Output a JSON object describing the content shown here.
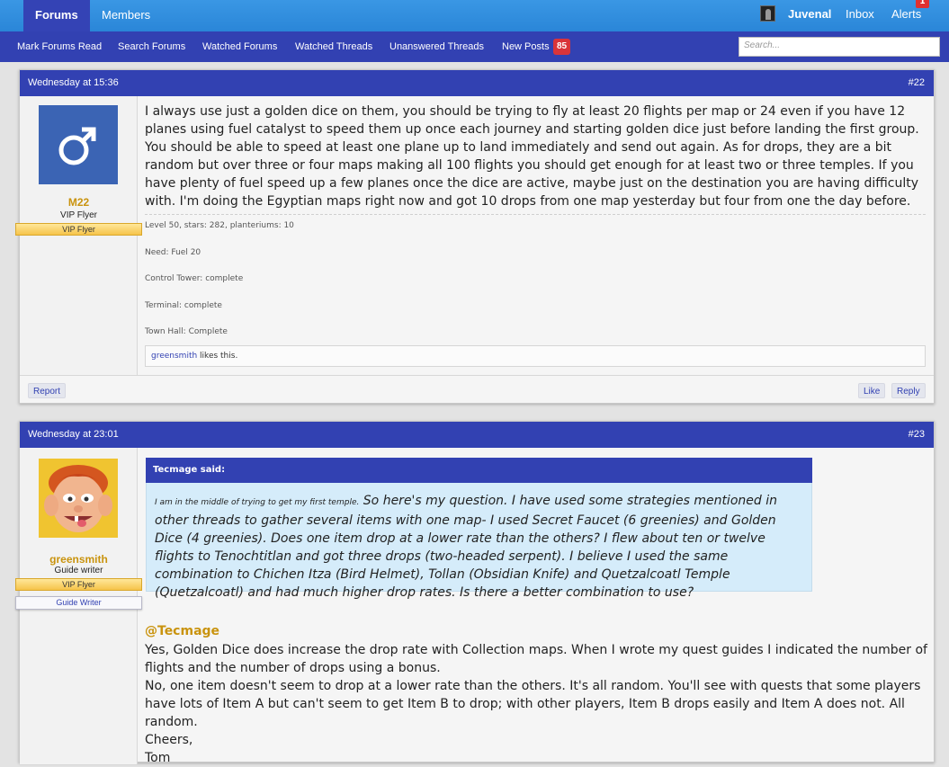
{
  "nav": {
    "tabs": [
      "Forums",
      "Members"
    ],
    "user_name": "Juvenal",
    "inbox": "Inbox",
    "alerts": "Alerts",
    "alerts_count": "1"
  },
  "subnav": {
    "links": [
      "Mark Forums Read",
      "Search Forums",
      "Watched Forums",
      "Watched Threads",
      "Unanswered Threads",
      "New Posts"
    ],
    "new_posts_count": "85",
    "search_placeholder": "Search..."
  },
  "posts": [
    {
      "date": "Wednesday at 15:36",
      "number": "#22",
      "author": "M22",
      "author_title": "VIP Flyer",
      "ribbon": "VIP Flyer",
      "avatar_icon": "male-symbol-icon",
      "avatar_color": "#3b64b4",
      "message": "I always use just a golden dice on them, you should be trying to fly at least 20 flights per map or 24 even if you have 12 planes using fuel catalyst to speed them up once each journey and starting golden dice just before landing the first group. You should be able to speed at least one plane up to land immediately and send out again. As for drops, they are a bit random but over three or four maps making all 100 flights you should get enough for at least two or three temples. If you have plenty of fuel speed up a few planes once the dice are active, maybe just on the destination you are having difficulty with. I'm doing the Egyptian maps right now and got 10 drops from one map yesterday but four from one the day before.",
      "signature": [
        "Level 50, stars: 282, planteriums: 10",
        "Need: Fuel 20",
        "Control Tower: complete",
        "Terminal: complete",
        "Town Hall: Complete"
      ],
      "liker": "greensmith",
      "likes_suffix": " likes this.",
      "report": "Report",
      "like": "Like",
      "reply": "Reply"
    },
    {
      "date": "Wednesday at 23:01",
      "number": "#23",
      "author": "greensmith",
      "author_title": "Guide writer",
      "ribbon": "VIP Flyer",
      "ribbon2": "Guide Writer",
      "quote_author": "Tecmage said:",
      "quote_small": "I am in the middle of trying to get my first temple.",
      "quote_text": " So here's my question. I have used some strategies mentioned in other threads to gather several items with one map- I used Secret Faucet (6 greenies) and Golden Dice (4 greenies). Does one item drop at a lower rate than the others? I flew about ten or twelve flights to Tenochtitlan and got three drops (two-headed serpent). I believe I used the same combination to Chichen Itza (Bird Helmet), Tollan (Obsidian Knife) and Quetzalcoatl Temple (Quetzalcoatl) and had much higher drop rates. Is there a better combination to use?",
      "mention": "@Tecmage",
      "reply_lines": [
        "Yes, Golden Dice does increase the drop rate with Collection maps. When I wrote my quest guides I indicated the number of flights and the number of drops using a bonus.",
        "No, one item doesn't seem to drop at a lower rate than the others. It's all random. You'll see with quests that some players have lots of Item A but can't seem to get Item B to drop; with other players, Item B drops easily and Item A does not. All random.",
        "Cheers,",
        "Tom"
      ]
    }
  ]
}
